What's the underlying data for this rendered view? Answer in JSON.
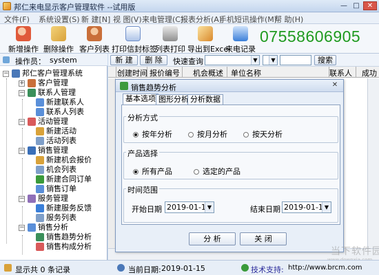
{
  "window": {
    "title": "邦仁来电显示客户管理软件 --试用版",
    "min": "—",
    "max": "□",
    "close": "✕"
  },
  "menu": [
    "文件(F)",
    "系统设置(S)",
    "新 建[N]",
    "视 图(V)",
    "来电管理(C)",
    "报表分析(A)",
    "手机短讯操作(M)",
    "帮 助(H)"
  ],
  "toolbar": {
    "items": [
      {
        "label": "新增操作",
        "icon": "add-user-icon",
        "color": "#e05a3a"
      },
      {
        "label": "删除操作",
        "icon": "delete-icon",
        "color": "#d9a23a"
      },
      {
        "label": "客户列表",
        "icon": "customers-icon",
        "color": "#c96f3a"
      },
      {
        "label": "打印信封标签",
        "icon": "envelope-icon",
        "color": "#6f8fc9"
      },
      {
        "label": "列表打印",
        "icon": "printer-icon",
        "color": "#7f7f7f"
      },
      {
        "label": "导出到Excel",
        "icon": "excel-chart-icon",
        "color": "#d9882a"
      },
      {
        "label": "来电记录",
        "icon": "phone-log-icon",
        "color": "#3a7fd9"
      }
    ],
    "phone": "07558606905"
  },
  "operator": {
    "label": "操作员：",
    "name": "system"
  },
  "tree": [
    {
      "text": "邦仁客户管理系统",
      "level": 0,
      "box": "−",
      "icon": "computer-icon",
      "color": "#4a78b8"
    },
    {
      "text": "客户管理",
      "level": 1,
      "box": "+",
      "icon": "customer-folder-icon",
      "color": "#c96f3a"
    },
    {
      "text": "联系人管理",
      "level": 1,
      "box": "−",
      "icon": "contacts-icon",
      "color": "#3a8f5a"
    },
    {
      "text": "新建联系人",
      "level": 2,
      "box": "",
      "icon": "new-contact-icon",
      "color": "#5a8fd9"
    },
    {
      "text": "联系人列表",
      "level": 2,
      "box": "",
      "icon": "contact-list-icon",
      "color": "#5a8fd9"
    },
    {
      "text": "活动管理",
      "level": 1,
      "box": "−",
      "icon": "activity-icon",
      "color": "#d95a5a"
    },
    {
      "text": "新建活动",
      "level": 2,
      "box": "",
      "icon": "new-activity-icon",
      "color": "#d9a23a"
    },
    {
      "text": "活动列表",
      "level": 2,
      "box": "",
      "icon": "activity-list-icon",
      "color": "#7f9fc9"
    },
    {
      "text": "销售管理",
      "level": 1,
      "box": "−",
      "icon": "sales-icon",
      "color": "#3a6fb8"
    },
    {
      "text": "新建机会报价",
      "level": 2,
      "box": "",
      "icon": "quote-icon",
      "color": "#d9a23a"
    },
    {
      "text": "机会列表",
      "level": 2,
      "box": "",
      "icon": "opportunity-list-icon",
      "color": "#7f9fc9"
    },
    {
      "text": "新建合同订单",
      "level": 2,
      "box": "",
      "icon": "contract-icon",
      "color": "#3a9a3a"
    },
    {
      "text": "销售订单",
      "level": 2,
      "box": "",
      "icon": "order-icon",
      "color": "#5a8fd9"
    },
    {
      "text": "服务管理",
      "level": 1,
      "box": "−",
      "icon": "service-icon",
      "color": "#8f6fb8"
    },
    {
      "text": "新建服务反馈",
      "level": 2,
      "box": "",
      "icon": "feedback-icon",
      "color": "#3a7fd9"
    },
    {
      "text": "服务列表",
      "level": 2,
      "box": "",
      "icon": "service-list-icon",
      "color": "#7f9fc9"
    },
    {
      "text": "销售分析",
      "level": 1,
      "box": "−",
      "icon": "analysis-icon",
      "color": "#5a8fd9"
    },
    {
      "text": "销售趋势分析",
      "level": 2,
      "box": "",
      "icon": "trend-icon",
      "color": "#3a8f5a"
    },
    {
      "text": "销售构成分析",
      "level": 2,
      "box": "",
      "icon": "composition-icon",
      "color": "#d95a5a"
    }
  ],
  "actionbar": {
    "new": "新 建",
    "delete": "删 除",
    "quick_query": "快速查询：",
    "search": "搜索"
  },
  "grid": {
    "columns": [
      "创建时间",
      "报价编号",
      "机会概述",
      "单位名称",
      "联系人",
      "成功"
    ]
  },
  "dialog": {
    "title": "销售趋势分析",
    "close": "✕",
    "tabs": [
      "基本选项",
      "图形分析",
      "分析数据"
    ],
    "group_method": "分析方式",
    "methods": [
      "按年分析",
      "按月分析",
      "按天分析"
    ],
    "group_product": "产品选择",
    "products": [
      "所有产品",
      "选定的产品"
    ],
    "group_time": "时间范围",
    "start_label": "开始日期",
    "start_value": "2019-01-15",
    "end_label": "结束日期",
    "end_value": "2019-01-15",
    "analyze": "分 析",
    "close_btn": "关 闭"
  },
  "status": {
    "count": "显示共 0 条记录",
    "date_label": "当前日期:",
    "date_value": "2019-01-15",
    "support_label": "技术支持:",
    "support_url": "http://www.brcm.com"
  },
  "watermark": {
    "text": "当下软件园",
    "sub": "www.downxia.com"
  }
}
